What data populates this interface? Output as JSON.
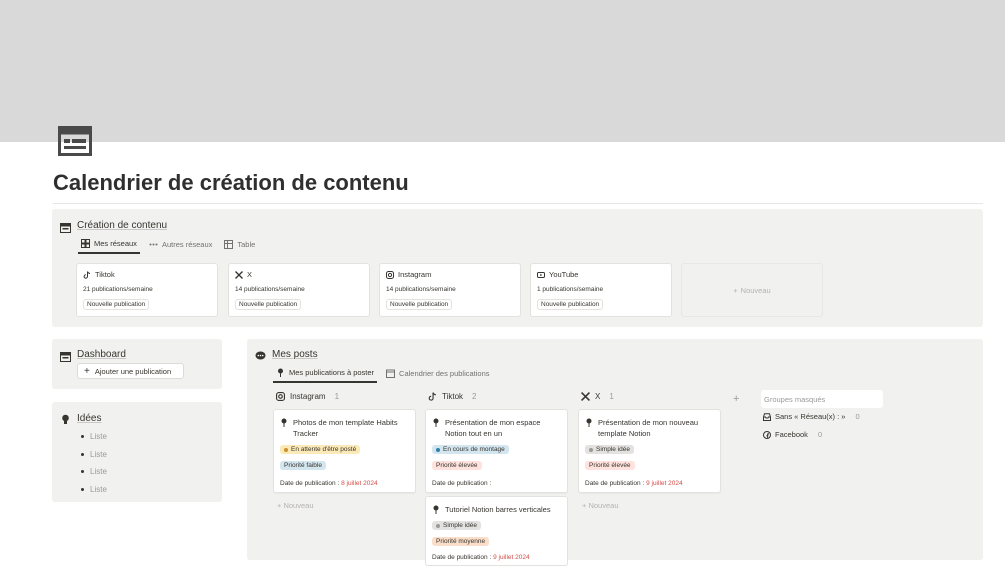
{
  "page": {
    "title": "Calendrier de création de contenu",
    "icon": "layout-icon"
  },
  "content_section": {
    "title": "Création de contenu",
    "tabs": [
      {
        "label": "Mes réseaux",
        "icon": "gallery-icon",
        "active": true
      },
      {
        "label": "Autres réseaux",
        "icon": "dots-icon",
        "active": false
      },
      {
        "label": "Table",
        "icon": "table-icon",
        "active": false
      }
    ],
    "cards": [
      {
        "name": "Tiktok",
        "icon": "tiktok-icon",
        "stat": "21 publications/semaine",
        "button": "Nouvelle publication"
      },
      {
        "name": "X",
        "icon": "x-icon",
        "stat": "14 publications/semaine",
        "button": "Nouvelle publication"
      },
      {
        "name": "Instagram",
        "icon": "instagram-icon",
        "stat": "14 publications/semaine",
        "button": "Nouvelle publication"
      },
      {
        "name": "YouTube",
        "icon": "youtube-icon",
        "stat": "1 publications/semaine",
        "button": "Nouvelle publication"
      }
    ],
    "new_label": "Nouveau"
  },
  "dashboard": {
    "title": "Dashboard",
    "button": "Ajouter une publication"
  },
  "ideas": {
    "title": "Idées",
    "items": [
      "Liste",
      "Liste",
      "Liste",
      "Liste"
    ]
  },
  "posts": {
    "title": "Mes posts",
    "tabs": [
      {
        "label": "Mes publications à poster",
        "icon": "pin-icon",
        "active": true
      },
      {
        "label": "Calendrier des publications",
        "icon": "calendar-icon",
        "active": false
      }
    ],
    "columns": [
      {
        "name": "Instagram",
        "icon": "instagram-icon",
        "count": "1"
      },
      {
        "name": "Tiktok",
        "icon": "tiktok-icon",
        "count": "2"
      },
      {
        "name": "X",
        "icon": "x-icon",
        "count": "1"
      }
    ],
    "cards": [
      {
        "title": "Photos de mon template Habits Tracker",
        "status": "En attente d'être posté",
        "priority": "Priorité faible",
        "date_label": "Date de publication : ",
        "date": "8 juillet 2024"
      },
      {
        "title": "Présentation de mon espace Notion tout en un",
        "status": "En cours de montage",
        "priority": "Priorité élevée",
        "date_label": "Date de publication :",
        "date": ""
      },
      {
        "title": "Tutoriel Notion barres verticales",
        "status": "Simple idée",
        "priority": "Priorité moyenne",
        "date_label": "Date de publication : ",
        "date": "9 juillet 2024"
      },
      {
        "title": "Présentation de mon nouveau template Notion",
        "status": "Simple idée",
        "priority": "Priorité élevée",
        "date_label": "Date de publication : ",
        "date": "9 juillet 2024"
      }
    ],
    "new_label": "Nouveau",
    "hidden_groups": {
      "placeholder": "Groupes masqués",
      "items": [
        {
          "name": "Sans « Réseau(x) : »",
          "icon": "inbox-icon",
          "count": "0"
        },
        {
          "name": "Facebook",
          "icon": "facebook-icon",
          "count": "0"
        }
      ]
    }
  },
  "colors": {
    "status_waiting": "#fbe9b7",
    "status_editing": "#d3e5ef",
    "status_idea": "#e3e2e0",
    "priority_low": "#d3e5ef",
    "priority_high": "#ffe2dd",
    "priority_medium": "#fadec9",
    "date_accent": "#d44c47"
  }
}
